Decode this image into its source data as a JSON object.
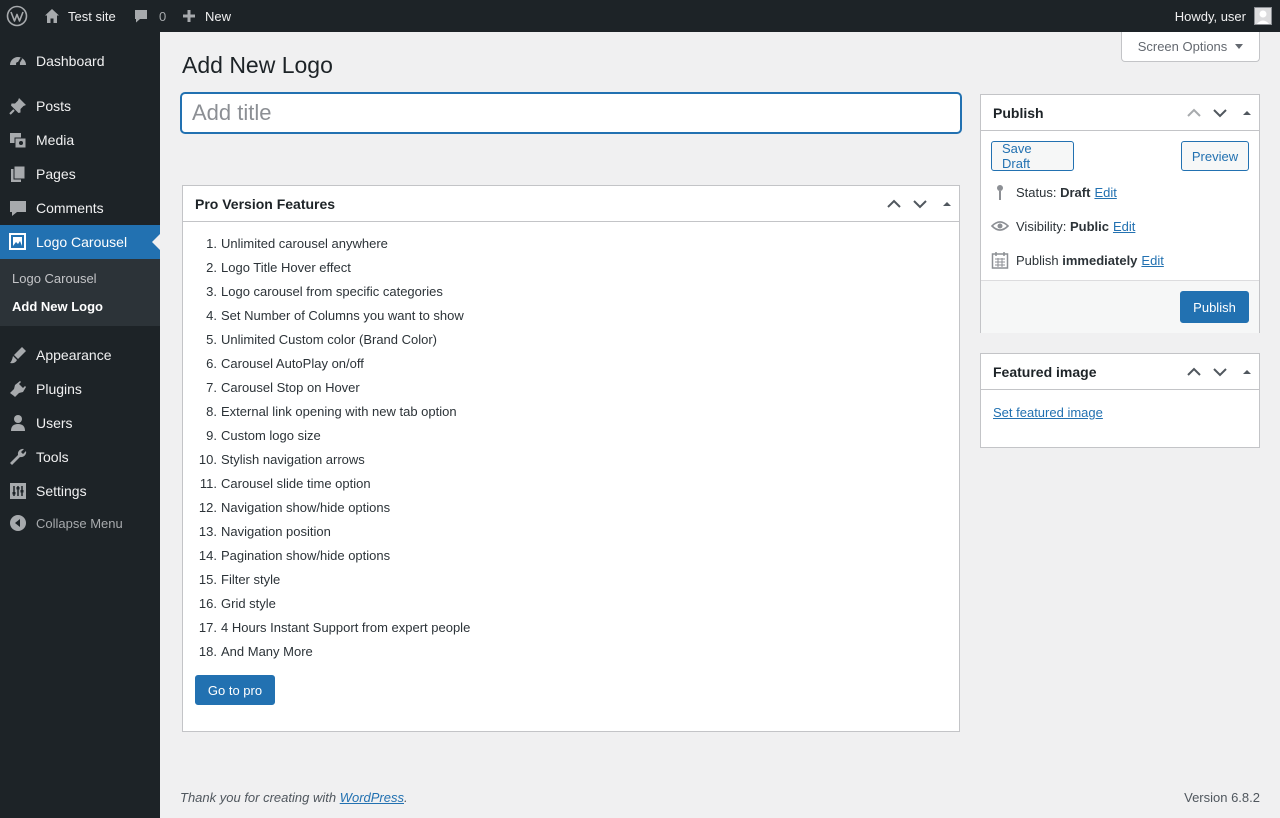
{
  "adminbar": {
    "site_name": "Test site",
    "comments_count": "0",
    "new_label": "New",
    "howdy": "Howdy, user"
  },
  "sidebar": {
    "items": [
      {
        "label": "Dashboard",
        "icon": "dashboard-icon"
      },
      {
        "label": "Posts",
        "icon": "pin-icon"
      },
      {
        "label": "Media",
        "icon": "media-icon"
      },
      {
        "label": "Pages",
        "icon": "pages-icon"
      },
      {
        "label": "Comments",
        "icon": "comment-icon"
      },
      {
        "label": "Logo Carousel",
        "icon": "images-icon"
      },
      {
        "label": "Appearance",
        "icon": "brush-icon"
      },
      {
        "label": "Plugins",
        "icon": "plug-icon"
      },
      {
        "label": "Users",
        "icon": "user-icon"
      },
      {
        "label": "Tools",
        "icon": "wrench-icon"
      },
      {
        "label": "Settings",
        "icon": "sliders-icon"
      }
    ],
    "submenu": [
      "Logo Carousel",
      "Add New Logo"
    ],
    "collapse_label": "Collapse Menu"
  },
  "screen_options_label": "Screen Options",
  "page_title": "Add New Logo",
  "title_placeholder": "Add title",
  "pro_box": {
    "title": "Pro Version Features",
    "features": [
      "Unlimited carousel anywhere",
      "Logo Title Hover effect",
      "Logo carousel from specific categories",
      "Set Number of Columns you want to show",
      "Unlimited Custom color (Brand Color)",
      "Carousel AutoPlay on/off",
      "Carousel Stop on Hover",
      "External link opening with new tab option",
      "Custom logo size",
      "Stylish navigation arrows",
      "Carousel slide time option",
      "Navigation show/hide options",
      "Navigation position",
      "Pagination show/hide options",
      "Filter style",
      "Grid style",
      "4 Hours Instant Support from expert people",
      "And Many More"
    ],
    "button": "Go to pro"
  },
  "publish": {
    "title": "Publish",
    "save_draft": "Save Draft",
    "preview": "Preview",
    "status_label": "Status:",
    "status_value": "Draft",
    "visibility_label": "Visibility:",
    "visibility_value": "Public",
    "publish_label": "Publish",
    "publish_value": "immediately",
    "edit": "Edit",
    "publish_button": "Publish"
  },
  "featured": {
    "title": "Featured image",
    "link": "Set featured image"
  },
  "footer": {
    "thanks_prefix": "Thank you for creating with ",
    "link": "WordPress",
    "thanks_suffix": ".",
    "version": "Version 6.8.2"
  },
  "colors": {
    "accent": "#2271b1",
    "sidebar_bg": "#1d2327",
    "page_bg": "#f0f0f1"
  }
}
